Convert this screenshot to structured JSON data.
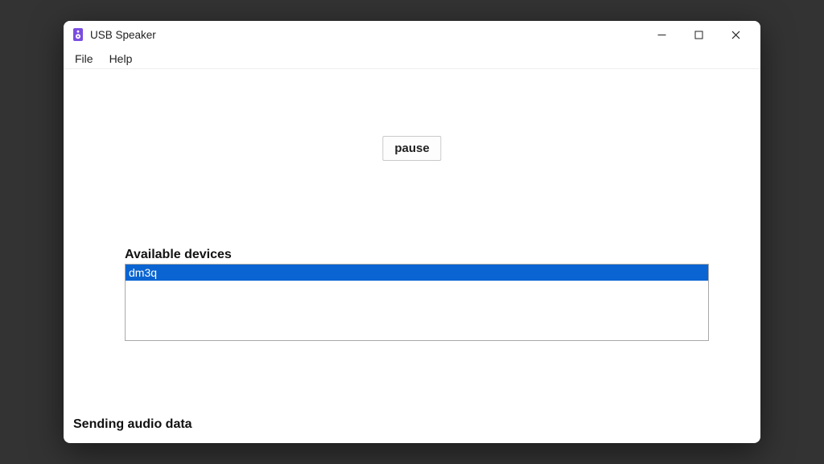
{
  "window": {
    "title": "USB Speaker"
  },
  "menu": {
    "file": "File",
    "help": "Help"
  },
  "main": {
    "pause_label": "pause",
    "devices_label": "Available devices",
    "devices": [
      {
        "name": "dm3q",
        "selected": true
      }
    ],
    "status": "Sending audio data"
  },
  "icons": {
    "app": "speaker-icon",
    "minimize": "minimize-icon",
    "maximize": "maximize-icon",
    "close": "close-icon"
  },
  "colors": {
    "selection": "#0a64d1",
    "app_icon": "#7a4de0"
  }
}
